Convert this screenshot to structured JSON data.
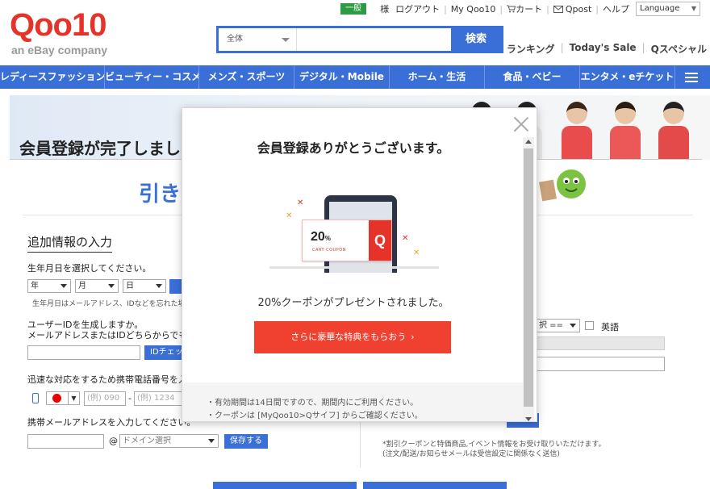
{
  "header": {
    "logo_text": "Qoo10",
    "logo_sub": "an eBay company",
    "member_badge": "一般",
    "top_links": [
      "様",
      "ログアウト",
      "My Qoo10",
      "カート",
      "Qpost",
      "ヘルプ"
    ],
    "language_label": "Language",
    "search": {
      "category": "全体",
      "placeholder": "",
      "button": "検索"
    },
    "sub_links": [
      "ランキング",
      "Today's Sale",
      "Qスペシャル"
    ]
  },
  "nav": {
    "categories": [
      "レディースファッション",
      "ビューティー・コスメ",
      "メンズ・スポーツ",
      "デジタル・Mobile",
      "ホーム・生活",
      "食品・ベビー",
      "エンタメ・eチケット"
    ]
  },
  "page": {
    "banner_title": "会員登録が完了しまし",
    "hikikae": "引き",
    "extra_title": "追加情報の入力",
    "birth_label": "生年月日を選択してください。",
    "birth_selects": [
      "年",
      "月",
      "日"
    ],
    "birth_note": "生年月日はメールアドレス、IDなどを忘れた場合",
    "userid_label_1": "ユーザーIDを生成しますか。",
    "userid_label_2": "メールアドレスまたはIDどちらからでもロ",
    "id_check_button": "IDチェッ",
    "phone_label": "迅速な対応をするため携帯電話番号を入",
    "phone_placeholder_1": "(例) 090",
    "phone_dash": "-",
    "phone_placeholder_2": "(例) 1234",
    "mobile_mail_label": "携帯メールアドレスを入力してください。",
    "at_mark": "@",
    "domain_select": "ドメイン選択",
    "save_button": "保存する",
    "right_select": "択 ==",
    "english_label": "英語",
    "right_note_1": "*割引クーポンと特価商品,イベント情報をお受け取りいただけます。",
    "right_note_2": "(注文/配送/お知らせメールは受信設定に関係なく送信)"
  },
  "modal": {
    "title": "会員登録ありがとうございます。",
    "coupon_percent": "20",
    "coupon_percent_sign": "%",
    "coupon_caption": "CART COUPON",
    "coupon_logo": "Q",
    "message": "20%クーポンがプレゼントされました。",
    "cta": "さらに豪華な特典をもらおう",
    "cta_arrow": "›",
    "footer_lines": [
      "・有効期間は14日間ですので、期間内にご利用ください。",
      "・クーポンは [MyQoo10>Qサイフ] からご確認ください。"
    ]
  },
  "colors": {
    "brand_red": "#e5332a",
    "brand_blue": "#3a6fd8",
    "badge_green": "#2d9b44",
    "cta_red": "#f0402f"
  }
}
